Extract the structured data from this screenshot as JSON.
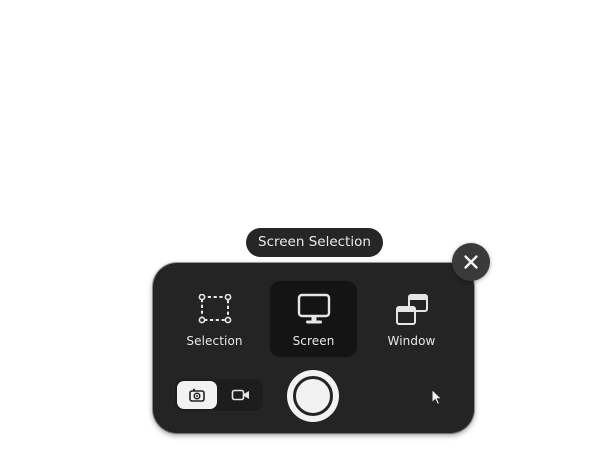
{
  "tooltip": {
    "text": "Screen Selection"
  },
  "modes": [
    {
      "label": "Selection",
      "icon": "selection-rectangle-icon",
      "active": false
    },
    {
      "label": "Screen",
      "icon": "monitor-icon",
      "active": true
    },
    {
      "label": "Window",
      "icon": "window-icon",
      "active": false
    }
  ],
  "capture_type": {
    "options": [
      {
        "icon": "camera-icon",
        "active": true
      },
      {
        "icon": "video-camera-icon",
        "active": false
      }
    ]
  },
  "controls": {
    "close_icon": "close-icon",
    "capture_icon": "shutter-icon",
    "pointer_icon": "mouse-pointer-icon"
  },
  "colors": {
    "panel": "#242424",
    "active_mode": "#141414",
    "tooltip": "#262626",
    "close_button": "#3a3a3a",
    "light": "#f2f2f2"
  }
}
